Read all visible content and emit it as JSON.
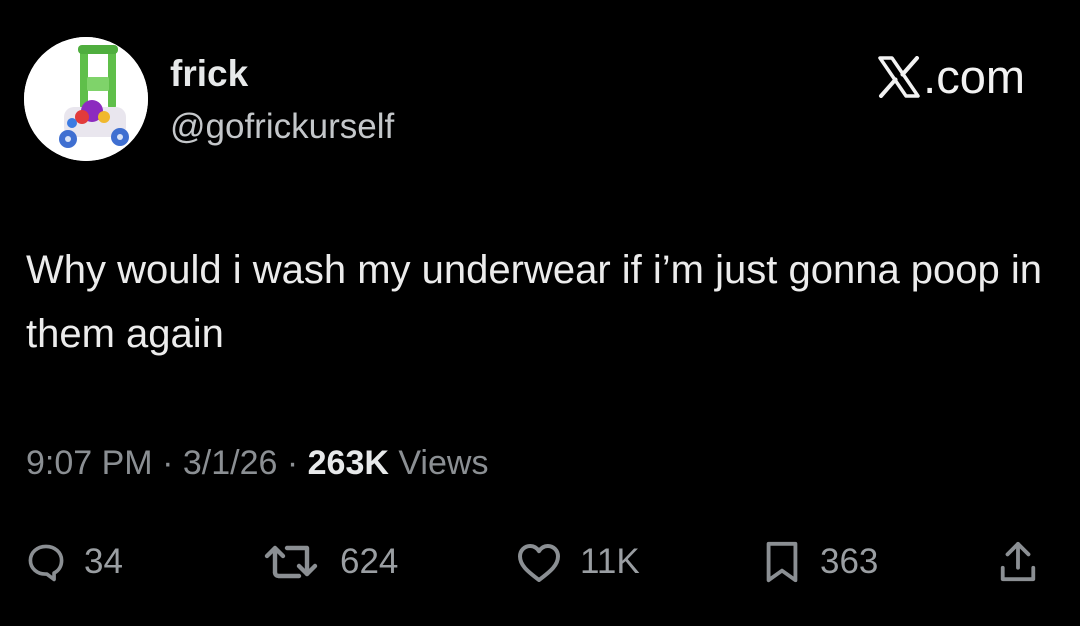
{
  "author": {
    "display_name": "frick",
    "handle": "@gofrickurself"
  },
  "brand": {
    "label": ".com",
    "logo_icon": "x-logo-icon"
  },
  "tweet": {
    "text": "Why would i wash my underwear if i’m just gonna poop in them again"
  },
  "meta": {
    "time": "9:07 PM",
    "date": "3/1/26",
    "separator": "·",
    "views_count": "263K",
    "views_label": "Views"
  },
  "actions": {
    "reply_count": "34",
    "retweet_count": "624",
    "like_count": "11K",
    "bookmark_count": "363"
  },
  "colors": {
    "background": "#000000",
    "primary_text": "#e7e9ea",
    "secondary_text": "#8b8f93"
  }
}
